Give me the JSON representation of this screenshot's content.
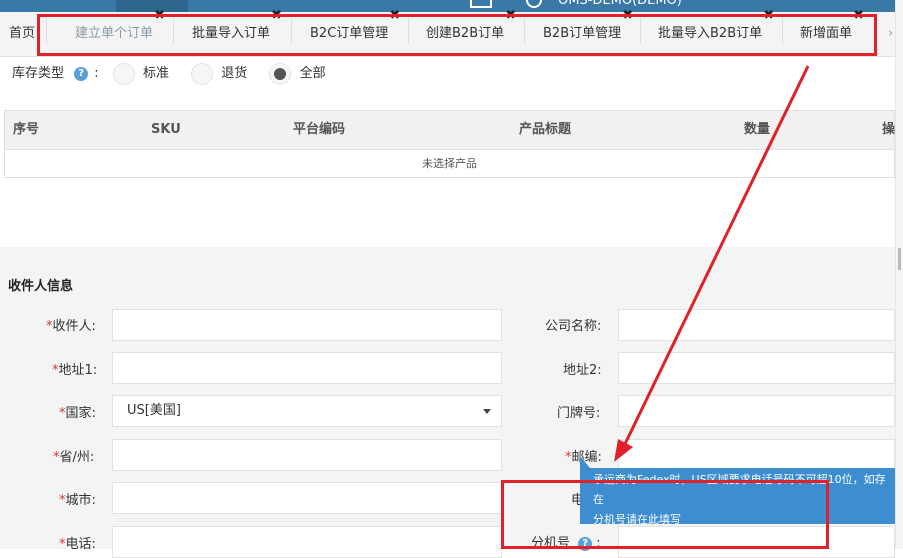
{
  "header": {
    "app_title": "OMS-DEMO(DEMO)"
  },
  "tabs": {
    "home_label": "首页",
    "items": [
      {
        "label": "建立单个订单",
        "active": true
      },
      {
        "label": "批量导入订单"
      },
      {
        "label": "B2C订单管理"
      },
      {
        "label": "创建B2B订单"
      },
      {
        "label": "B2B订单管理"
      },
      {
        "label": "批量导入B2B订单"
      },
      {
        "label": "新增面单"
      }
    ],
    "close_symbol": "✖",
    "overflow_symbol": "›"
  },
  "inventory_type": {
    "label": "库存类型",
    "help_symbol": "?",
    "colon": ":",
    "options": [
      {
        "label": "标准",
        "checked": false
      },
      {
        "label": "退货",
        "checked": false
      },
      {
        "label": "全部",
        "checked": true
      }
    ]
  },
  "product_table": {
    "columns": [
      "序号",
      "SKU",
      "平台编码",
      "产品标题",
      "数量",
      "操"
    ],
    "empty_text": "未选择产品"
  },
  "recipient": {
    "section_title": "收件人信息",
    "required_mark": "*",
    "fields": {
      "recipient_label": "收件人:",
      "address1_label": "地址1:",
      "country_label": "国家:",
      "country_value": "US[美国]",
      "state_label": "省/州:",
      "city_label": "城市:",
      "phone_label": "电话:",
      "company_label": "公司名称:",
      "address2_label": "地址2:",
      "door_label": "门牌号:",
      "postcode_label": "邮编:",
      "hidden_label_fragment": "电",
      "extension_label": "分机号",
      "extension_colon": ":"
    }
  },
  "tooltip": {
    "line1": "承运商为Fedex时，US区域要求电话号码不可超10位，如存在",
    "line2": "分机号请在此填写"
  },
  "colors": {
    "topbar": "#3a78a8",
    "highlight": "#e0202a",
    "tooltip": "#3d8ed0",
    "required": "#dd3333"
  }
}
